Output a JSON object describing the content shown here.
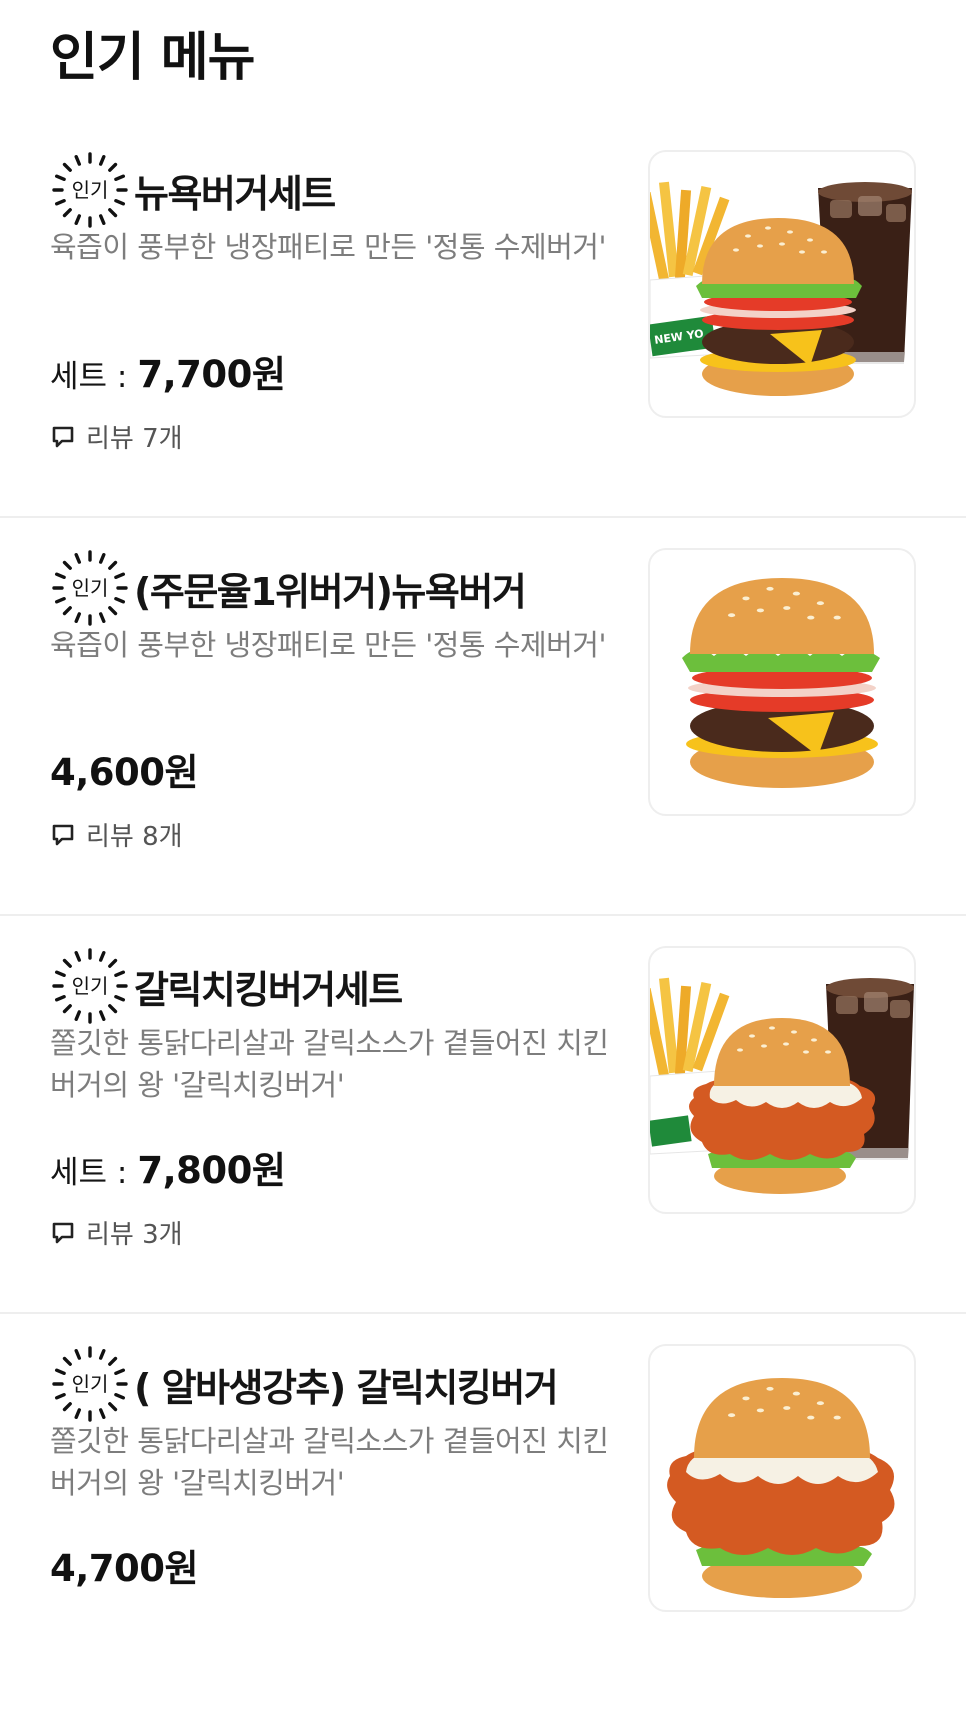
{
  "section": {
    "title": "인기 메뉴"
  },
  "badge_label": "인기",
  "items": [
    {
      "name": "뉴욕버거세트",
      "description": "육즙이 풍부한 냉장패티로 만든 '정통 수제버거'",
      "price_prefix": "세트 :",
      "price": "7,700원",
      "reviews": "리뷰 7개",
      "image_icon": "burger-set-with-fries-and-cola"
    },
    {
      "name": "(주문율1위버거)뉴욕버거",
      "description": "육즙이 풍부한 냉장패티로 만든 '정통 수제버거'",
      "price_prefix": "",
      "price": "4,600원",
      "reviews": "리뷰 8개",
      "image_icon": "beef-burger"
    },
    {
      "name": "갈릭치킹버거세트",
      "description": "쫄깃한 통닭다리살과 갈릭소스가 곁들어진 치킨버거의 왕 '갈릭치킹버거'",
      "price_prefix": "세트 :",
      "price": "7,800원",
      "reviews": "리뷰 3개",
      "image_icon": "chicken-burger-set-with-fries-and-cola"
    },
    {
      "name": "( 알바생강추) 갈릭치킹버거",
      "description": "쫄깃한 통닭다리살과 갈릭소스가 곁들어진 치킨버거의 왕 '갈릭치킹버거'",
      "price_prefix": "",
      "price": "4,700원",
      "reviews": "",
      "image_icon": "chicken-burger"
    }
  ],
  "colors": {
    "badge": "#111111",
    "description": "#7d7d7d",
    "divider": "#eeeeee",
    "bun": "#e6a04a",
    "lettuce": "#6cbf3c",
    "tomato": "#e53b28",
    "patty": "#4a2a1c",
    "cheese": "#f7c21b",
    "fried_chicken": "#d45a22",
    "cola": "#3a2016",
    "fries": "#f2b632"
  }
}
